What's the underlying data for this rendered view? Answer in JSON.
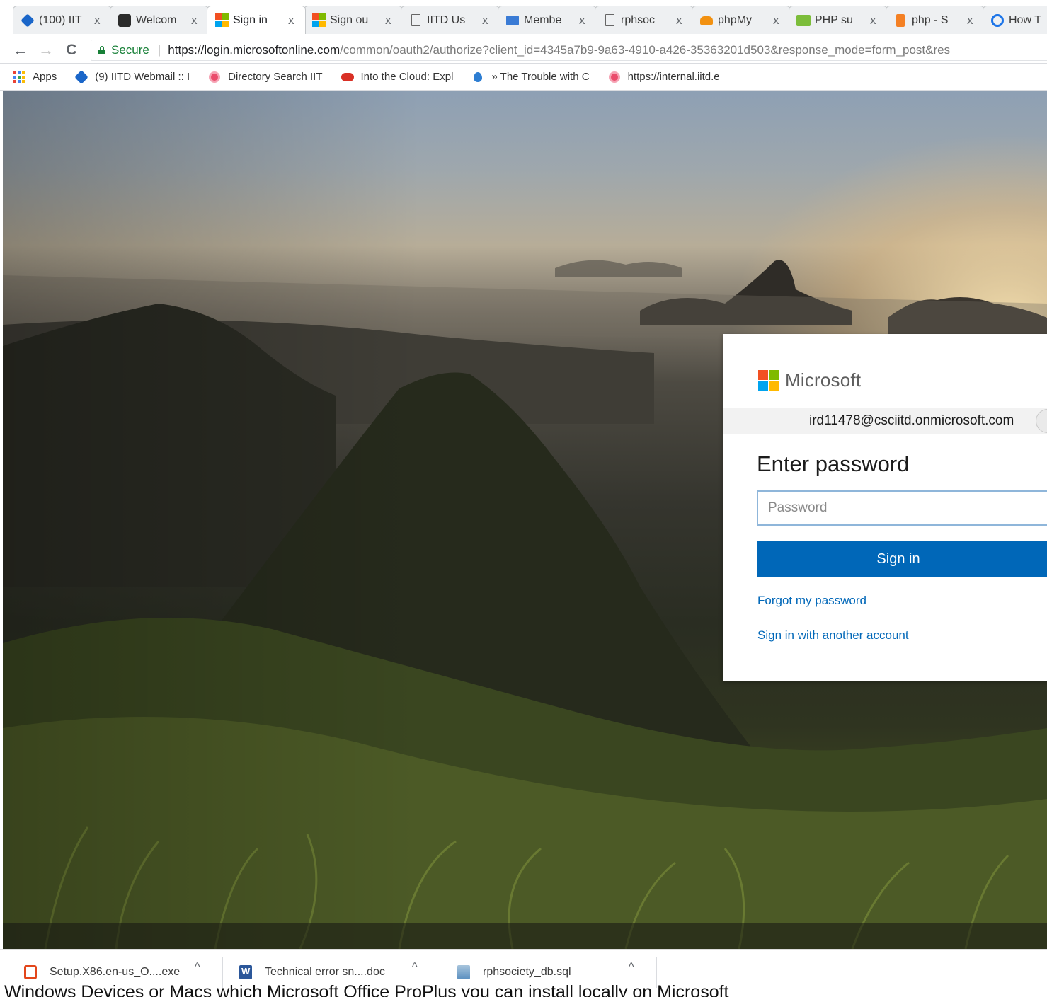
{
  "browser": {
    "tabs": [
      {
        "title": "(100) IIT",
        "icon": "webmail-icon"
      },
      {
        "title": "Welcom",
        "icon": "welcome-icon"
      },
      {
        "title": "Sign in",
        "icon": "microsoft-logo-icon",
        "active": true
      },
      {
        "title": "Sign ou",
        "icon": "microsoft-logo-icon"
      },
      {
        "title": "IITD Us",
        "icon": "page-icon"
      },
      {
        "title": "Membe",
        "icon": "members-icon"
      },
      {
        "title": "rphsoc",
        "icon": "page-icon"
      },
      {
        "title": "phpMy",
        "icon": "phpmyadmin-icon"
      },
      {
        "title": "PHP su",
        "icon": "php-icon"
      },
      {
        "title": "php - S",
        "icon": "stackoverflow-icon"
      },
      {
        "title": "How T",
        "icon": "how-to-icon"
      }
    ],
    "tab_close_glyph": "x",
    "nav": {
      "back": "←",
      "forward": "→",
      "reload": "C"
    },
    "address": {
      "secure_label": "Secure",
      "separator": "|",
      "url_host": "https://login.microsoftonline.com",
      "url_path": "/common/oauth2/authorize?client_id=4345a7b9-9a63-4910-a426-35363201d503&response_mode=form_post&res"
    },
    "bookmarks": [
      {
        "label": "Apps",
        "icon": "apps-grid-icon"
      },
      {
        "label": "(9) IITD Webmail :: I",
        "icon": "webmail-icon"
      },
      {
        "label": "Directory Search IIT",
        "icon": "directory-icon"
      },
      {
        "label": "Into the Cloud: Expl",
        "icon": "cloud-icon"
      },
      {
        "label": "» The Trouble with C",
        "icon": "drop-icon"
      },
      {
        "label": "https://internal.iitd.e",
        "icon": "internal-icon"
      }
    ]
  },
  "signin": {
    "brand": "Microsoft",
    "identity": "ird11478@csciitd.onmicrosoft.com",
    "heading": "Enter password",
    "password_placeholder": "Password",
    "signin_button": "Sign in",
    "forgot_link": "Forgot my password",
    "another_account_link": "Sign in with another account"
  },
  "downloads": [
    {
      "filename": "Setup.X86.en-us_O....exe",
      "icon": "office-installer-icon"
    },
    {
      "filename": "Technical error sn....doc",
      "icon": "word-document-icon"
    },
    {
      "filename": "rphsociety_db.sql",
      "icon": "sql-file-icon"
    }
  ],
  "download_caret": "^",
  "caption": "Windows Devices or Macs which Microsoft Office ProPlus you can install locally on Microsoft",
  "colors": {
    "signin_blue": "#0067b8",
    "secure_green": "#188038",
    "ms_red": "#f25022",
    "ms_green": "#7fba00",
    "ms_blue": "#00a4ef",
    "ms_yellow": "#ffb900"
  }
}
